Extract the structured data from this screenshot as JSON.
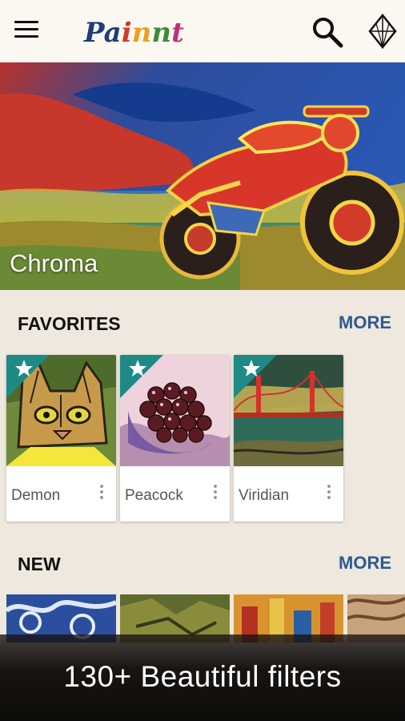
{
  "app": {
    "logo_text": "Painnt"
  },
  "topbar": {
    "menu_icon": "hamburger-menu-icon",
    "search_icon": "search-icon",
    "premium_icon": "diamond-icon"
  },
  "hero": {
    "title": "Chroma"
  },
  "favorites": {
    "title": "FAVORITES",
    "more_label": "MORE",
    "items": [
      {
        "label": "Demon",
        "starred": true
      },
      {
        "label": "Peacock",
        "starred": true
      },
      {
        "label": "Viridian",
        "starred": true
      }
    ]
  },
  "new": {
    "title": "NEW",
    "more_label": "MORE"
  },
  "promo": {
    "text": "130+ Beautiful filters"
  },
  "colors": {
    "accent_blue": "#2d5b92",
    "ribbon_teal": "#1e8a86",
    "background": "#efe8df"
  }
}
